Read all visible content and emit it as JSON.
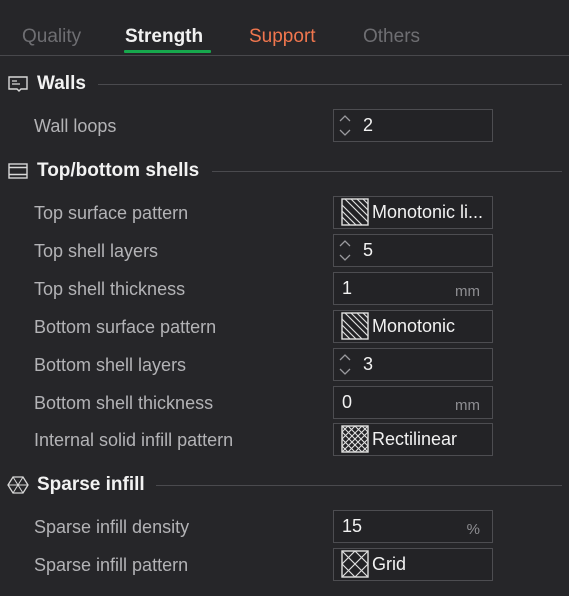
{
  "tabs": {
    "quality": "Quality",
    "strength": "Strength",
    "support": "Support",
    "others": "Others",
    "active": "Strength"
  },
  "colors": {
    "background": "#262629",
    "active_underline": "#17a84d",
    "support_tab": "#f0764e",
    "inactive_tab": "#6e6e72"
  },
  "walls": {
    "title": "Walls",
    "icon": "walls-icon",
    "wall_loops": {
      "label": "Wall loops",
      "value": "2"
    }
  },
  "shells": {
    "title": "Top/bottom shells",
    "icon": "shells-icon",
    "top_surface_pattern": {
      "label": "Top surface pattern",
      "value": "Monotonic li...",
      "icon": "monotonic-pattern-icon"
    },
    "top_shell_layers": {
      "label": "Top shell layers",
      "value": "5"
    },
    "top_shell_thickness": {
      "label": "Top shell thickness",
      "value": "1",
      "unit": "mm"
    },
    "bottom_surface_pattern": {
      "label": "Bottom surface pattern",
      "value": "Monotonic",
      "icon": "monotonic-pattern-icon"
    },
    "bottom_shell_layers": {
      "label": "Bottom shell layers",
      "value": "3"
    },
    "bottom_shell_thickness": {
      "label": "Bottom shell thickness",
      "value": "0",
      "unit": "mm"
    },
    "internal_solid_infill_pattern": {
      "label": "Internal solid infill pattern",
      "value": "Rectilinear",
      "icon": "rectilinear-pattern-icon"
    }
  },
  "sparse": {
    "title": "Sparse infill",
    "icon": "sparse-infill-icon",
    "density": {
      "label": "Sparse infill density",
      "value": "15",
      "unit": "%"
    },
    "pattern": {
      "label": "Sparse infill pattern",
      "value": "Grid",
      "icon": "grid-pattern-icon"
    }
  }
}
